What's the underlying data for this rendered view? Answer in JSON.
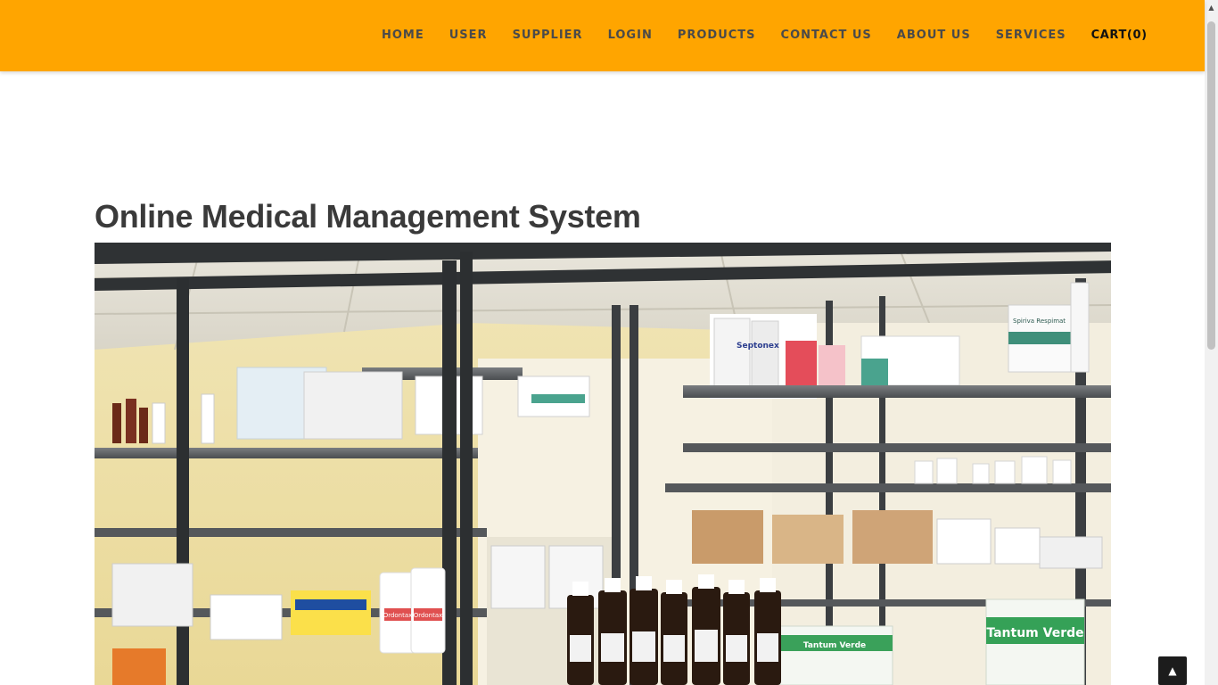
{
  "nav": {
    "items": [
      {
        "label": "HOME"
      },
      {
        "label": "USER"
      },
      {
        "label": "SUPPLIER"
      },
      {
        "label": "LOGIN"
      },
      {
        "label": "PRODUCTS"
      },
      {
        "label": "CONTACT US"
      },
      {
        "label": "ABOUT US"
      },
      {
        "label": "SERVICES"
      }
    ],
    "cart_label": "CART(0)",
    "background_color": "#ffa500"
  },
  "main": {
    "title": "Online Medical Management System",
    "hero_image": {
      "product_labels": [
        "Septonex",
        "Spiriva Respimat",
        "Tantum Verde",
        "Tantum Verde",
        "Ordontax",
        "Ordontax"
      ]
    }
  },
  "back_to_top": {
    "icon": "chevron-up-icon"
  }
}
